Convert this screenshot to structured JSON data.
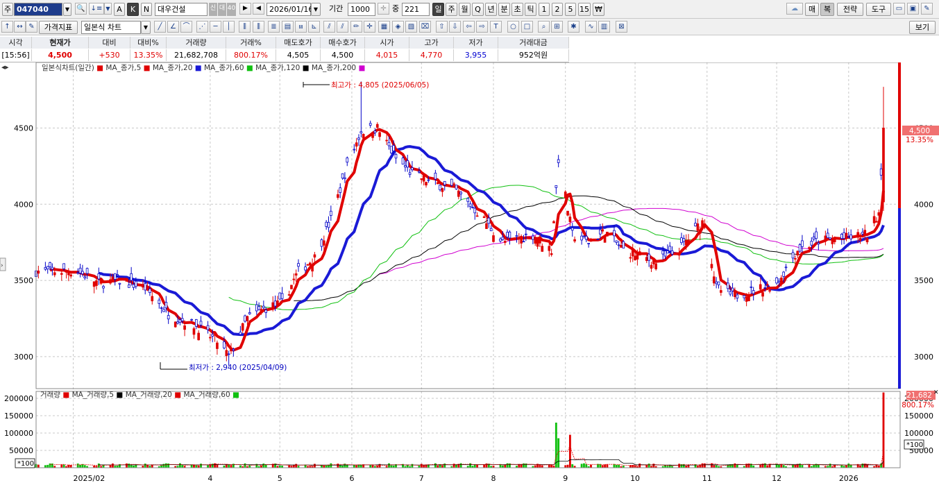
{
  "toolbar1": {
    "market_label": "주",
    "stock_code": "047040",
    "stock_name": "대우건설",
    "credit_badge": "신",
    "loan_badge": "대",
    "margin_badge": "40",
    "date": "2026/01/16",
    "period_label": "기간",
    "period_value": "1000",
    "mid_label": "중",
    "mid_value": "221",
    "ak_letters": [
      "A",
      "K",
      "N"
    ],
    "intervals": [
      "일",
      "주",
      "월",
      "Q",
      "년",
      "분",
      "초",
      "틱",
      "1",
      "2",
      "5",
      "15"
    ],
    "currency_symbol": "₩",
    "right_buttons": [
      "매",
      "복",
      "전략",
      "도구"
    ]
  },
  "toolbar2": {
    "indicator_label": "가격지표",
    "chart_type": "일본식 차트",
    "view_button": "보기"
  },
  "quote": {
    "headers": [
      "시각",
      "현재가",
      "대비",
      "대비%",
      "거래량",
      "거래%",
      "매도호가",
      "매수호가",
      "시가",
      "고가",
      "저가",
      "거래대금"
    ],
    "values": [
      "[15:56]",
      "4,500",
      "+530",
      "13.35%",
      "21,682,708",
      "800.17%",
      "4,505",
      "4,500",
      "4,015",
      "4,770",
      "3,955",
      "952억원"
    ]
  },
  "legend": {
    "price_title": "일본식차트(일간)",
    "price_ma": [
      "MA_종가,5",
      "MA_종가,20",
      "MA_종가,60",
      "MA_종가,120",
      "MA_종가,200"
    ],
    "volume_title": "거래량",
    "volume_ma": [
      "MA_거래량,5",
      "MA_거래량,20",
      "MA_거래량,60"
    ]
  },
  "annotations": {
    "high": "최고가 : 4,805 (2025/06/05)",
    "low": "최저가 : 2,940 (2025/04/09)",
    "price_tag": "4,500",
    "change_tag": "13.35%",
    "volume_tag": "21,682",
    "volume_change_tag": "800.17%",
    "volume_unit": "*100"
  },
  "colors": {
    "up": "#e00000",
    "down": "#0000c8",
    "ma5": "#e00000",
    "ma20": "#1a1ad6",
    "ma60": "#10c010",
    "ma120": "#000000",
    "ma200": "#d000d0",
    "volume_up": "#e00000",
    "volume_down": "#10c010"
  },
  "chart_data": {
    "type": "candlestick",
    "price_axis": {
      "ticks": [
        3000,
        3500,
        4000,
        4500
      ],
      "range": [
        2790,
        4930
      ]
    },
    "volume_axis": {
      "ticks": [
        50000,
        100000,
        150000,
        200000
      ],
      "range": [
        0,
        220000
      ]
    },
    "x_labels": [
      "2025/02",
      "4",
      "5",
      "6",
      "7",
      "8",
      "9",
      "10",
      "11",
      "12",
      "2026"
    ],
    "grid": true,
    "close_anchors": [
      {
        "date": "2025/01/16",
        "close": 3560
      },
      {
        "date": "2025/02/03",
        "close": 3560
      },
      {
        "date": "2025/02/12",
        "close": 3480
      },
      {
        "date": "2025/02/20",
        "close": 3500
      },
      {
        "date": "2025/03/04",
        "close": 3450
      },
      {
        "date": "2025/03/14",
        "close": 3280
      },
      {
        "date": "2025/03/26",
        "close": 3200
      },
      {
        "date": "2025/04/04",
        "close": 3100
      },
      {
        "date": "2025/04/09",
        "close": 3000
      },
      {
        "date": "2025/04/17",
        "close": 3250
      },
      {
        "date": "2025/04/25",
        "close": 3320
      },
      {
        "date": "2025/05/02",
        "close": 3350
      },
      {
        "date": "2025/05/09",
        "close": 3560
      },
      {
        "date": "2025/05/16",
        "close": 3650
      },
      {
        "date": "2025/05/23",
        "close": 3900
      },
      {
        "date": "2025/05/30",
        "close": 4250
      },
      {
        "date": "2025/06/05",
        "close": 4480
      },
      {
        "date": "2025/06/12",
        "close": 4500
      },
      {
        "date": "2025/06/20",
        "close": 4300
      },
      {
        "date": "2025/06/27",
        "close": 4200
      },
      {
        "date": "2025/07/04",
        "close": 4150
      },
      {
        "date": "2025/07/15",
        "close": 4100
      },
      {
        "date": "2025/07/25",
        "close": 3950
      },
      {
        "date": "2025/08/05",
        "close": 3750
      },
      {
        "date": "2025/08/18",
        "close": 3800
      },
      {
        "date": "2025/08/26",
        "close": 3700
      },
      {
        "date": "2025/08/29",
        "close": 4300
      },
      {
        "date": "2025/09/04",
        "close": 3800
      },
      {
        "date": "2025/09/11",
        "close": 3750
      },
      {
        "date": "2025/09/18",
        "close": 3820
      },
      {
        "date": "2025/09/26",
        "close": 3700
      },
      {
        "date": "2025/10/10",
        "close": 3620
      },
      {
        "date": "2025/10/20",
        "close": 3700
      },
      {
        "date": "2025/10/28",
        "close": 3850
      },
      {
        "date": "2025/10/31",
        "close": 3900
      },
      {
        "date": "2025/11/05",
        "close": 3450
      },
      {
        "date": "2025/11/12",
        "close": 3400
      },
      {
        "date": "2025/11/20",
        "close": 3430
      },
      {
        "date": "2025/12/01",
        "close": 3480
      },
      {
        "date": "2025/12/10",
        "close": 3700
      },
      {
        "date": "2025/12/19",
        "close": 3760
      },
      {
        "date": "2026/01/02",
        "close": 3780
      },
      {
        "date": "2026/01/09",
        "close": 3800
      },
      {
        "date": "2026/01/14",
        "close": 3950
      },
      {
        "date": "2026/01/16",
        "close": 4500
      }
    ],
    "high_point": {
      "date": "2025/06/05",
      "price": 4805
    },
    "low_point": {
      "date": "2025/04/09",
      "price": 2940
    },
    "last_candle": {
      "date": "2026/01/16",
      "open": 4015,
      "high": 4770,
      "low": 3955,
      "close": 4500,
      "volume": 21682708
    },
    "volume_spikes": [
      {
        "date": "2025/08/28",
        "volume": 130000
      },
      {
        "date": "2025/08/29",
        "volume": 85000
      },
      {
        "date": "2025/09/03",
        "volume": 95000
      },
      {
        "date": "2026/01/16",
        "volume": 216827
      }
    ]
  }
}
